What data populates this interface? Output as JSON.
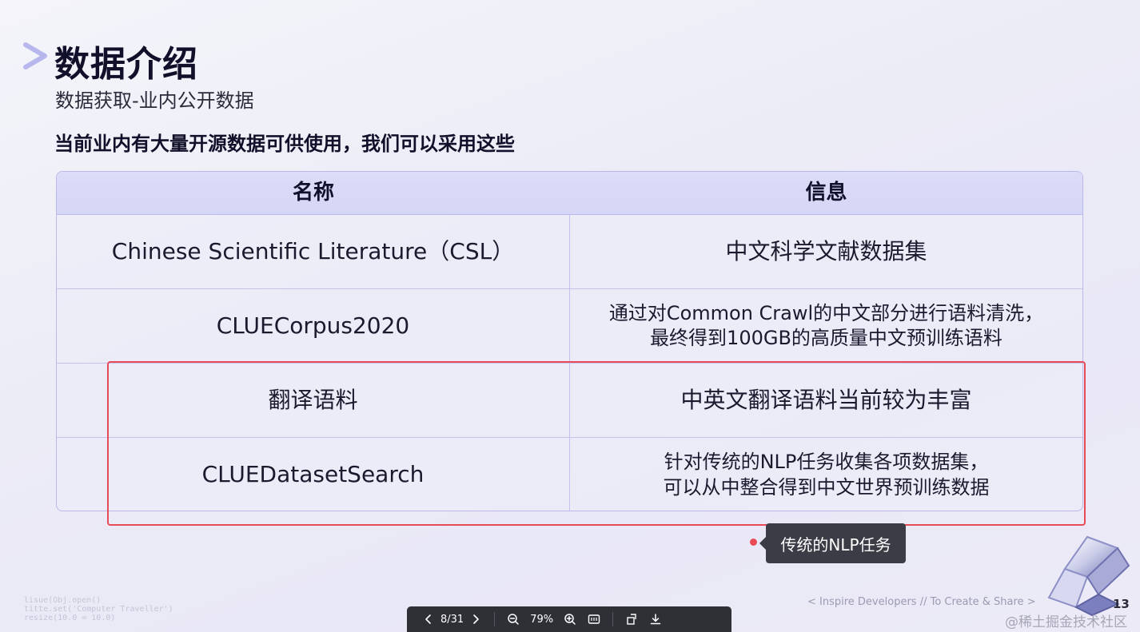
{
  "slide": {
    "title": "数据介绍",
    "subtitle": "数据获取-业内公开数据",
    "intro": "当前业内有大量开源数据可供使用，我们可以采用这些",
    "table": {
      "headers": [
        "名称",
        "信息"
      ],
      "rows": [
        {
          "name": "Chinese Scientific Literature（CSL）",
          "info": [
            "中文科学文献数据集"
          ]
        },
        {
          "name": "CLUECorpus2020",
          "info": [
            "通过对Common Crawl的中文部分进行语料清洗，",
            "最终得到100GB的高质量中文预训练语料"
          ]
        },
        {
          "name": "翻译语料",
          "info": [
            "中英文翻译语料当前较为丰富"
          ]
        },
        {
          "name": "CLUEDatasetSearch",
          "info": [
            "针对传统的NLP任务收集各项数据集，",
            "可以从中整合得到中文世界预训练数据"
          ]
        }
      ]
    },
    "annotation": {
      "note": "传统的NLP任务",
      "color": "#e84b55"
    },
    "code_snippet": [
      "lisue(Obj.open()",
      "titte.set('Computer Traveller')",
      "resize(10.0 = 10.0)"
    ],
    "footer_tagline": "< Inspire Developers  //  To Create & Share >",
    "page_number": "13"
  },
  "viewer": {
    "page_indicator": "8/31",
    "zoom": "79%",
    "icons": [
      "chevron-left-icon",
      "chevron-right-icon",
      "zoom-out-icon",
      "zoom-in-icon",
      "fit-page-icon",
      "rotate-icon",
      "download-icon"
    ]
  },
  "watermark": "@稀土掘金技术社区",
  "colors": {
    "accent": "#e84b55",
    "table_header": "#d8d8f7",
    "table_border": "#b9b9ec",
    "toolbar": "#2f3036"
  }
}
